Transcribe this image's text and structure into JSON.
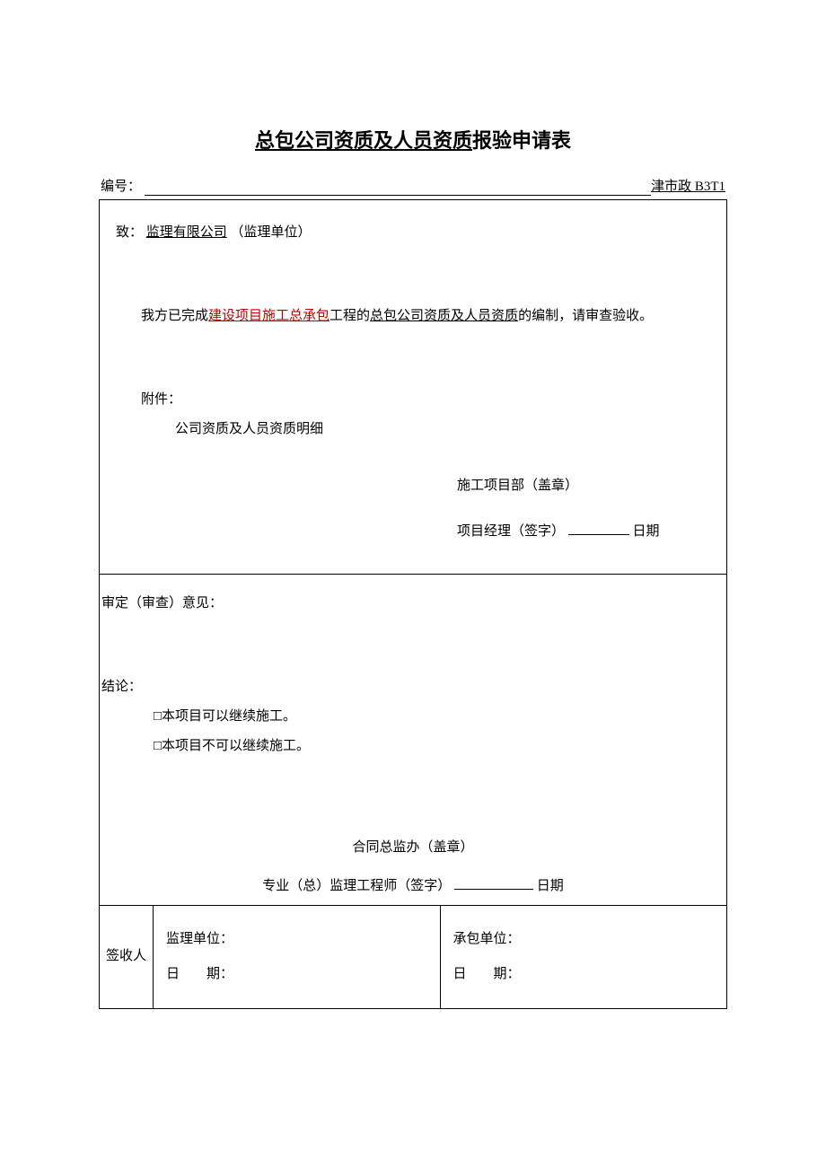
{
  "title_underline": "总包公司资质及人员资质",
  "title_rest": "报验申请表",
  "meta": {
    "number_label": "编号：",
    "doc_code": "津市政 B3T1"
  },
  "upper": {
    "to_label": "致：",
    "to_company": "监理有限公司",
    "to_suffix": "（监理单位）",
    "body_prefix": "我方已完成",
    "body_project": "建设项目施工总承包",
    "body_mid": "工程的",
    "body_subject": "总包公司资质及人员资质",
    "body_suffix": "的编制，请审查验收。",
    "attachment_label": "附件：",
    "attachment_item": "公司资质及人员资质明细",
    "sig_dept": "施工项目部（盖章）",
    "sig_pm_prefix": "项目经理（签字）",
    "sig_date": "日期"
  },
  "middle": {
    "opinion_label": "审定（审查）意见：",
    "conclusion_label": "结论：",
    "opt1": "□本项目可以继续施工。",
    "opt2": "□本项目不可以继续施工。",
    "sig_office": "合同总监办（盖章）",
    "sig_engineer_prefix": "专业（总）监理工程师（签字）",
    "sig_date": "日期"
  },
  "bottom": {
    "row_label": "签收人",
    "col1_line1": "监理单位：",
    "col1_line2_a": "日",
    "col1_line2_b": "期：",
    "col2_line1": "承包单位：",
    "col2_line2_a": "日",
    "col2_line2_b": "期："
  }
}
